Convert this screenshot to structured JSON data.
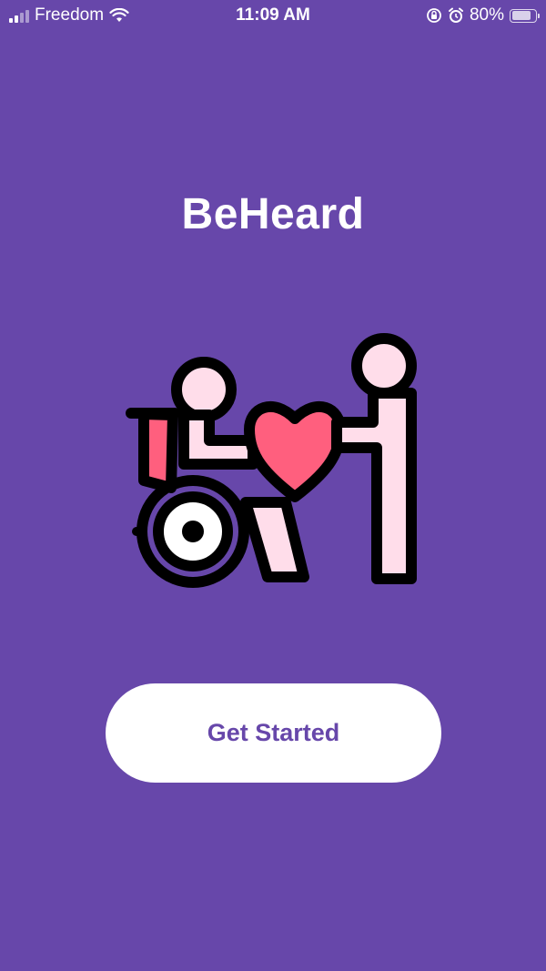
{
  "status_bar": {
    "carrier": "Freedom",
    "time": "11:09 AM",
    "battery_percent": "80%",
    "battery_level": 0.8,
    "icons": [
      "signal-icon",
      "wifi-icon",
      "orientation-lock-icon",
      "alarm-icon",
      "battery-icon"
    ]
  },
  "app": {
    "title": "BeHeard"
  },
  "illustration": {
    "icon": "wheelchair-caregiver-heart-icon"
  },
  "actions": {
    "get_started_label": "Get Started"
  },
  "colors": {
    "background": "#6747AA",
    "button_bg": "#FFFFFF",
    "button_text": "#6747AA",
    "heart": "#FF5F7E",
    "figure_fill": "#FFDDEA"
  }
}
